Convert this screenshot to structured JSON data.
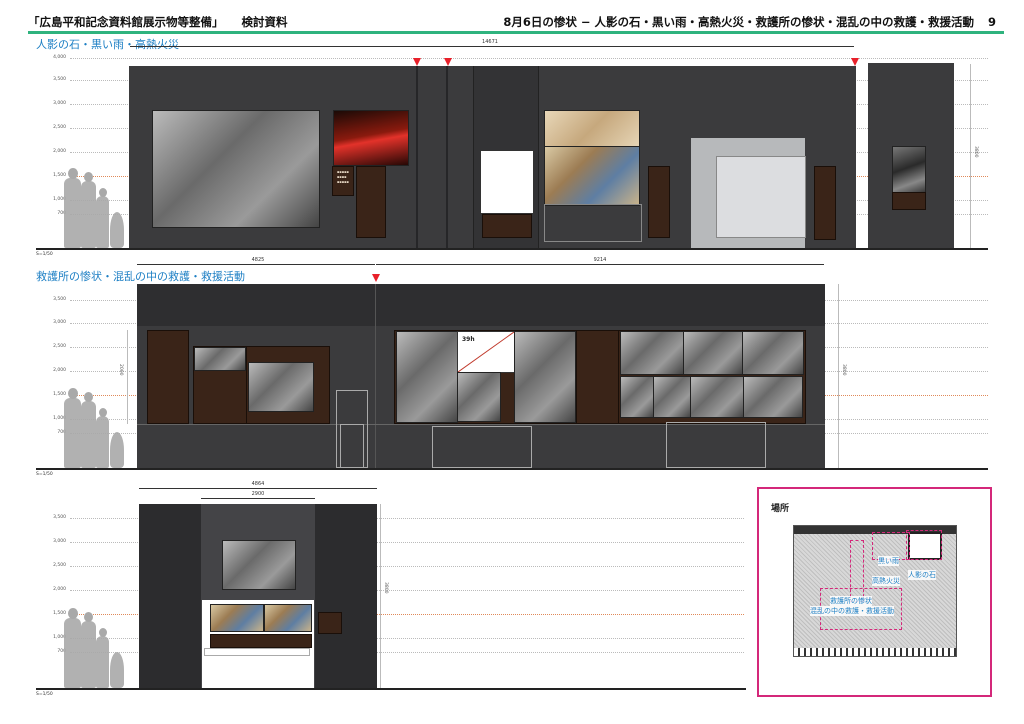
{
  "header": {
    "left_title": "「広島平和記念資料館展示物等整備」",
    "left_sub": "検討資料",
    "right_title": "8月6日の惨状 − 人影の石・黒い雨・高熱火災・救護所の惨状・混乱の中の救護・救援活動",
    "page_number": "9"
  },
  "sections": {
    "s1_title": "人影の石・黒い雨・高熱火災",
    "s2_title": "救護所の惨状・混乱の中の救護・救援活動"
  },
  "scale_labels": [
    "4,000",
    "3,500",
    "3,000",
    "2,500",
    "2,000",
    "1,500",
    "1,000",
    "700"
  ],
  "scale_labels_s3": [
    "3,500",
    "3,000",
    "2,500",
    "2,000",
    "1,500",
    "1,000",
    "700"
  ],
  "scale_note": "S=1/50",
  "dims": {
    "s1_total": "14671",
    "s1_height": "3800",
    "s2_left": "4825",
    "s2_right": "9214",
    "s2_left_h": "2000",
    "s2_height": "3800",
    "s3_total": "4864",
    "s3_inner": "2900",
    "s3_height": "3800"
  },
  "panel_labels": {
    "s2_chart_label": "39h"
  },
  "map": {
    "title": "場所",
    "labels": {
      "black_rain": "黒い雨",
      "fire": "高熱火災",
      "shadow_stone": "人影の石",
      "relief_1": "救護所の惨状",
      "relief_2": "混乱の中の救護・救援活動"
    }
  },
  "colors": {
    "wall": "#3b3b3d",
    "panel": "#3a2418",
    "accent_green": "#2fb37e",
    "section_blue": "#1d7fc4",
    "map_border": "#d4287a",
    "arrow_red": "#e8202a"
  }
}
